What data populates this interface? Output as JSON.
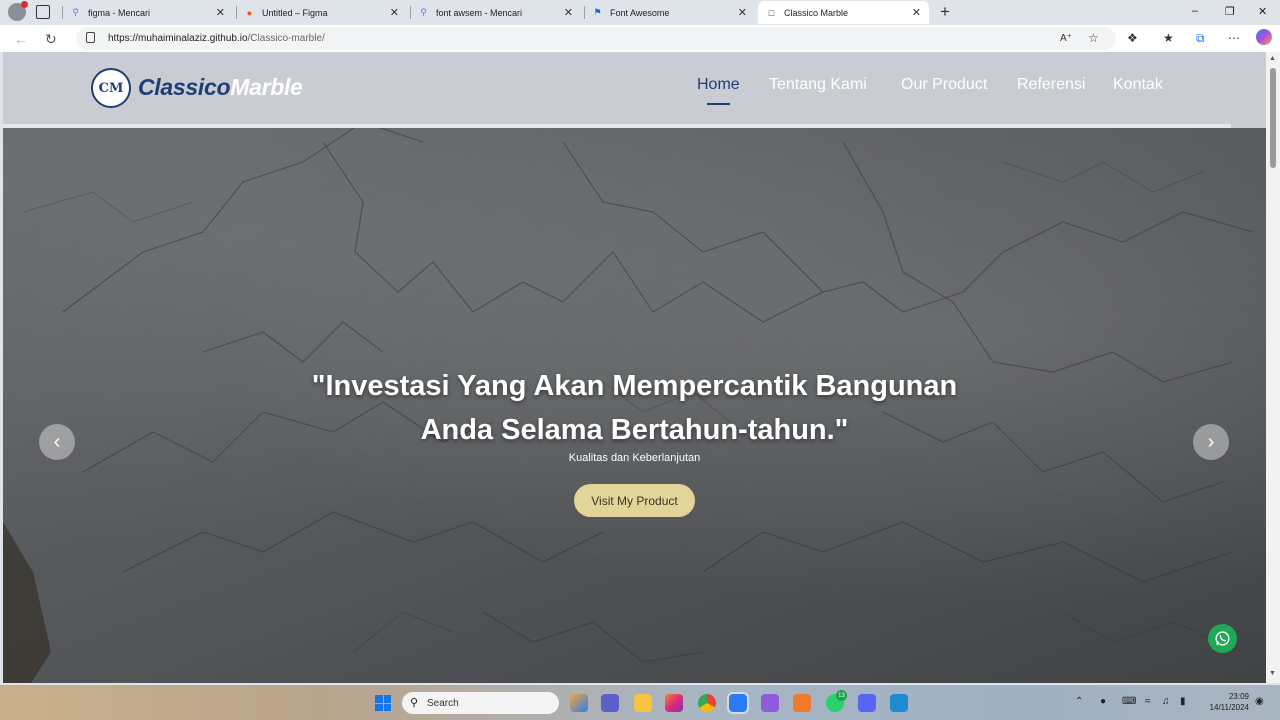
{
  "browser": {
    "tabs": [
      {
        "title": "figma - Mencari",
        "icon": "search-icon"
      },
      {
        "title": "Untitled – Figma",
        "icon": "figma-icon"
      },
      {
        "title": "font awsem - Mencari",
        "icon": "search-icon"
      },
      {
        "title": "Font Awesome",
        "icon": "flag-icon"
      },
      {
        "title": "Classico Marble",
        "icon": "page-icon"
      }
    ],
    "url_host": "https://muhaiminalaziz.github.io",
    "url_path": "/Classico-marble/"
  },
  "site": {
    "logo_monogram": "CM",
    "logo_word1": "Classico",
    "logo_word2": "Marble",
    "nav": [
      "Home",
      "Tentang Kami",
      "Our Product",
      "Referensi",
      "Kontak"
    ],
    "active_nav": "Home",
    "accent_color": "#1f3f74",
    "cta_color": "#e3d49a"
  },
  "hero": {
    "headline_line1": "\"Investasi Yang Akan Mempercantik Bangunan",
    "headline_line2": "Anda Selama Bertahun-tahun.\"",
    "subtitle": "Kualitas dan Keberlanjutan",
    "cta_label": "Visit My Product"
  },
  "taskbar": {
    "search_label": "Search",
    "badge_count": "13",
    "time": "23:09",
    "date": "14/11/2024"
  }
}
